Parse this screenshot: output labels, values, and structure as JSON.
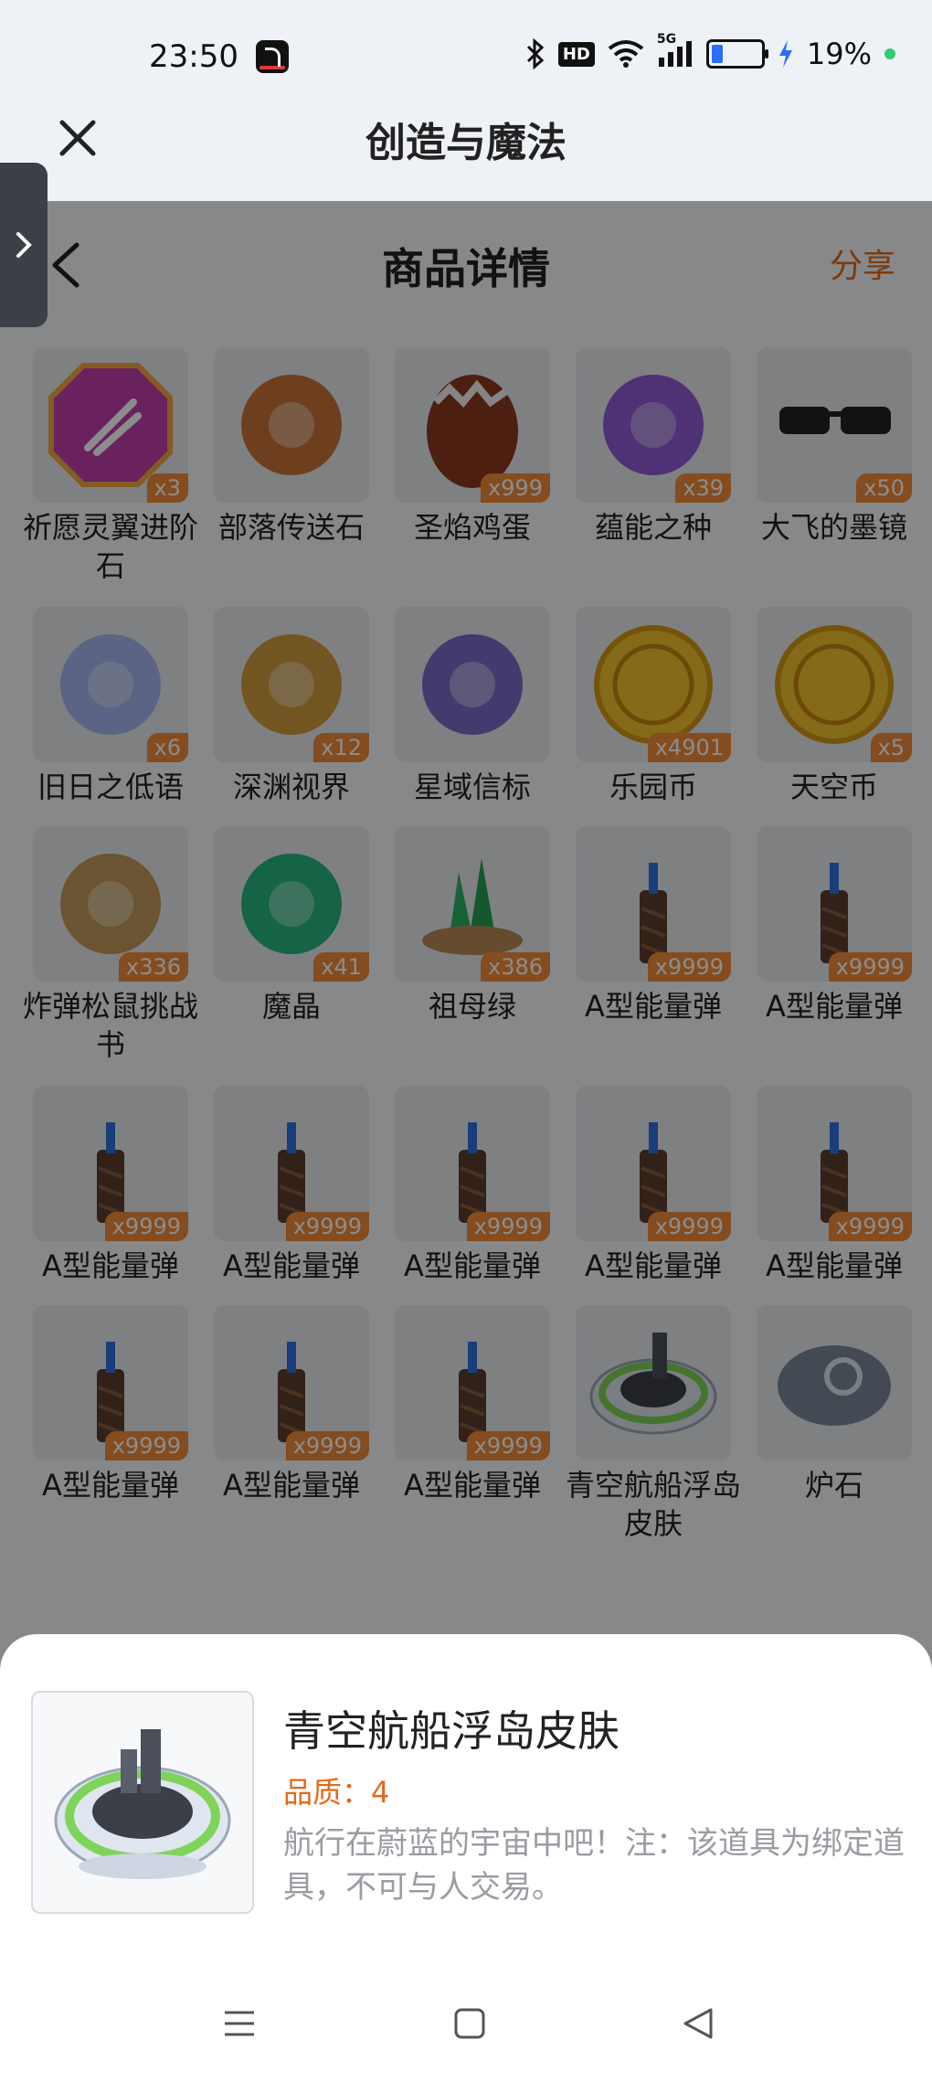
{
  "status_bar": {
    "time": "23:50",
    "network": "5G",
    "hd": "HD",
    "battery_percent": "19%",
    "battery_level": 0.19
  },
  "app_bar": {
    "title": "创造与魔法",
    "close_icon": "close-icon"
  },
  "page_header": {
    "title": "商品详情",
    "share_label": "分享",
    "back_icon": "back-icon"
  },
  "items": [
    {
      "name": "祈愿灵翼进阶石",
      "qty": "x3",
      "color": "#c23fae"
    },
    {
      "name": "部落传送石",
      "qty": "",
      "color": "#c9743a"
    },
    {
      "name": "圣焰鸡蛋",
      "qty": "x999",
      "color": "#8b3a1f"
    },
    {
      "name": "蕴能之种",
      "qty": "x39",
      "color": "#8e5bd6"
    },
    {
      "name": "大飞的墨镜",
      "qty": "x50",
      "color": "#222222"
    },
    {
      "name": "旧日之低语",
      "qty": "x6",
      "color": "#a7b7f0"
    },
    {
      "name": "深渊视界",
      "qty": "x12",
      "color": "#d19b3d"
    },
    {
      "name": "星域信标",
      "qty": "",
      "color": "#7d6ac9"
    },
    {
      "name": "乐园币",
      "qty": "x4901",
      "color": "#f2c12e"
    },
    {
      "name": "天空币",
      "qty": "x5",
      "color": "#f2c12e"
    },
    {
      "name": "炸弹松鼠挑战书",
      "qty": "x336",
      "color": "#c49a5a"
    },
    {
      "name": "魔晶",
      "qty": "x41",
      "color": "#25b67e"
    },
    {
      "name": "祖母绿",
      "qty": "x386",
      "color": "#2fb364"
    },
    {
      "name": "A型能量弹",
      "qty": "x9999",
      "color": "#5a3d2e"
    },
    {
      "name": "A型能量弹",
      "qty": "x9999",
      "color": "#5a3d2e"
    },
    {
      "name": "A型能量弹",
      "qty": "x9999",
      "color": "#5a3d2e"
    },
    {
      "name": "A型能量弹",
      "qty": "x9999",
      "color": "#5a3d2e"
    },
    {
      "name": "A型能量弹",
      "qty": "x9999",
      "color": "#5a3d2e"
    },
    {
      "name": "A型能量弹",
      "qty": "x9999",
      "color": "#5a3d2e"
    },
    {
      "name": "A型能量弹",
      "qty": "x9999",
      "color": "#5a3d2e"
    },
    {
      "name": "A型能量弹",
      "qty": "x9999",
      "color": "#5a3d2e"
    },
    {
      "name": "A型能量弹",
      "qty": "x9999",
      "color": "#5a3d2e"
    },
    {
      "name": "A型能量弹",
      "qty": "x9999",
      "color": "#5a3d2e"
    },
    {
      "name": "青空航船浮岛皮肤",
      "qty": "",
      "color": "#7fd35a"
    },
    {
      "name": "炉石",
      "qty": "",
      "color": "#7a8899"
    }
  ],
  "detail_sheet": {
    "title": "青空航船浮岛皮肤",
    "quality": "品质：4",
    "description": "航行在蔚蓝的宇宙中吧！注：该道具为绑定道具，不可与人交易。"
  },
  "colors": {
    "accent": "#e06a1b",
    "qty_badge": "#f08a3a"
  },
  "nav_bar": [
    "menu-icon",
    "home-icon",
    "back-triangle-icon"
  ]
}
